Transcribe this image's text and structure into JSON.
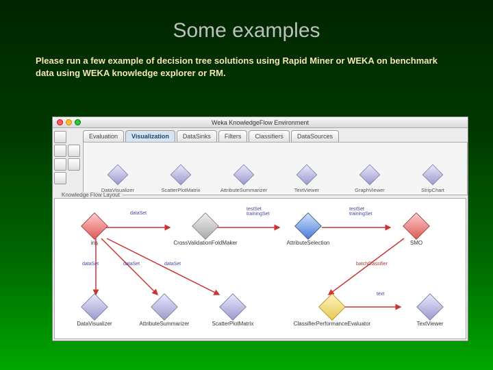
{
  "slide": {
    "title": "Some examples",
    "subtitle": "Please run a few example of decision tree solutions using Rapid Miner or WEKA on benchmark data using WEKA knowledge explorer or RM."
  },
  "app": {
    "window_title": "Weka KnowledgeFlow Environment",
    "tabs": [
      "Evaluation",
      "Visualization",
      "DataSinks",
      "Filters",
      "Classifiers",
      "DataSources"
    ],
    "active_tab": "Visualization",
    "palette": [
      {
        "label": "DataVisualizer"
      },
      {
        "label": "ScatterPlotMatrix"
      },
      {
        "label": "AttributeSummarizer"
      },
      {
        "label": "TextViewer"
      },
      {
        "label": "GraphViewer"
      },
      {
        "label": "StripChart"
      }
    ],
    "layout_title": "Knowledge Flow Layout",
    "nodes": {
      "iris": "iris",
      "cvfm": "CrossValidationFoldMaker",
      "attrsel": "AttributeSelection",
      "smo": "SMO",
      "dataviz": "DataVisualizer",
      "attrsum": "AttributeSummarizer",
      "spm": "ScatterPlotMatrix",
      "cpe": "ClassifierPerformanceEvaluator",
      "textv": "TextViewer"
    },
    "tags": {
      "dataset1": "dataSet",
      "testtrain1": "testSet\ntrainingSet",
      "testtrain2": "testSet\ntrainingSet",
      "dataset2a": "dataSet",
      "dataset2b": "dataSet",
      "dataset2c": "dataSet",
      "batchcls": "batchClassifier",
      "text": "text"
    }
  }
}
